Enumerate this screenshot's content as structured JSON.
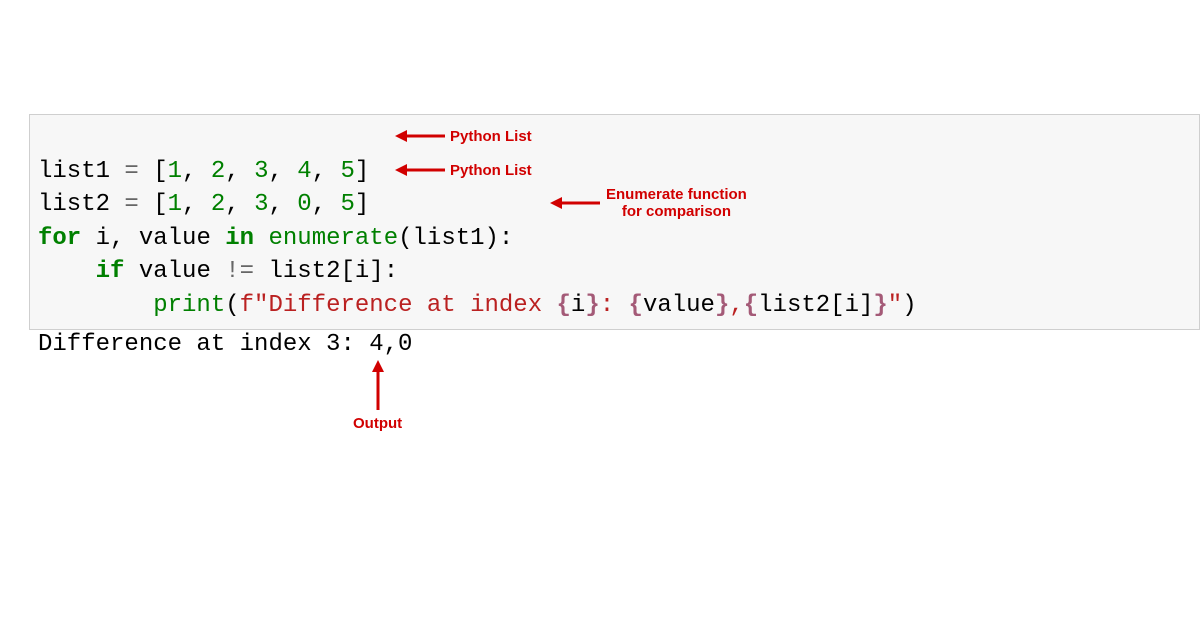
{
  "code": {
    "line1": {
      "var": "list1",
      "eq": " = ",
      "open": "[",
      "n1": "1",
      "c1": ", ",
      "n2": "2",
      "c2": ", ",
      "n3": "3",
      "c3": ", ",
      "n4": "4",
      "c4": ", ",
      "n5": "5",
      "close": "]"
    },
    "line2": {
      "var": "list2",
      "eq": " = ",
      "open": "[",
      "n1": "1",
      "c1": ", ",
      "n2": "2",
      "c2": ", ",
      "n3": "3",
      "c3": ", ",
      "n4": "0",
      "c4": ", ",
      "n5": "5",
      "close": "]"
    },
    "line3": {
      "for": "for",
      "sp1": " ",
      "i": "i",
      "comma": ", ",
      "value": "value",
      "sp2": " ",
      "in": "in",
      "sp3": " ",
      "enum": "enumerate",
      "open": "(",
      "arg": "list1",
      "close": "):"
    },
    "line4": {
      "indent": "    ",
      "if": "if",
      "sp1": " ",
      "value": "value",
      "sp2": " ",
      "neq": "!=",
      "sp3": " ",
      "arr": "list2",
      "open": "[",
      "idx": "i",
      "close": "]:"
    },
    "line5": {
      "indent": "        ",
      "print": "print",
      "open": "(",
      "f": "f\"",
      "s1": "Difference at index ",
      "i1o": "{",
      "i1": "i",
      "i1c": "}",
      "s2": ": ",
      "i2o": "{",
      "i2": "value",
      "i2c": "}",
      "s3": ",",
      "i3o": "{",
      "i3": "list2[i]",
      "i3c": "}",
      "endq": "\"",
      "close": ")"
    }
  },
  "output": {
    "text": "Difference at index 3: 4,0"
  },
  "annotations": {
    "list1": "Python List",
    "list2": "Python List",
    "enum1": "Enumerate function",
    "enum2": "for comparison",
    "output": "Output"
  },
  "colors": {
    "red": "#d10000"
  }
}
